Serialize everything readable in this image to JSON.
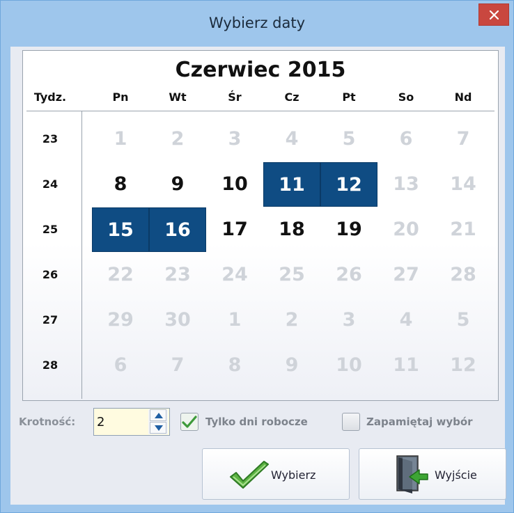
{
  "window": {
    "title": "Wybierz daty"
  },
  "calendar": {
    "month_title": "Czerwiec 2015",
    "week_header": "Tydz.",
    "day_headers": [
      "Pn",
      "Wt",
      "Śr",
      "Cz",
      "Pt",
      "So",
      "Nd"
    ],
    "weeks": [
      {
        "number": "23",
        "days": [
          {
            "d": "1",
            "s": "other"
          },
          {
            "d": "2",
            "s": "other"
          },
          {
            "d": "3",
            "s": "other"
          },
          {
            "d": "4",
            "s": "other"
          },
          {
            "d": "5",
            "s": "other"
          },
          {
            "d": "6",
            "s": "other"
          },
          {
            "d": "7",
            "s": "other"
          }
        ]
      },
      {
        "number": "24",
        "days": [
          {
            "d": "8",
            "s": "cur"
          },
          {
            "d": "9",
            "s": "cur"
          },
          {
            "d": "10",
            "s": "cur"
          },
          {
            "d": "11",
            "s": "sel"
          },
          {
            "d": "12",
            "s": "sel"
          },
          {
            "d": "13",
            "s": "other"
          },
          {
            "d": "14",
            "s": "other"
          }
        ]
      },
      {
        "number": "25",
        "days": [
          {
            "d": "15",
            "s": "sel"
          },
          {
            "d": "16",
            "s": "sel"
          },
          {
            "d": "17",
            "s": "cur"
          },
          {
            "d": "18",
            "s": "cur"
          },
          {
            "d": "19",
            "s": "cur"
          },
          {
            "d": "20",
            "s": "other"
          },
          {
            "d": "21",
            "s": "other"
          }
        ]
      },
      {
        "number": "26",
        "days": [
          {
            "d": "22",
            "s": "other"
          },
          {
            "d": "23",
            "s": "other"
          },
          {
            "d": "24",
            "s": "other"
          },
          {
            "d": "25",
            "s": "other"
          },
          {
            "d": "26",
            "s": "other"
          },
          {
            "d": "27",
            "s": "other"
          },
          {
            "d": "28",
            "s": "other"
          }
        ]
      },
      {
        "number": "27",
        "days": [
          {
            "d": "29",
            "s": "other"
          },
          {
            "d": "30",
            "s": "other"
          },
          {
            "d": "1",
            "s": "other"
          },
          {
            "d": "2",
            "s": "other"
          },
          {
            "d": "3",
            "s": "other"
          },
          {
            "d": "4",
            "s": "other"
          },
          {
            "d": "5",
            "s": "other"
          }
        ]
      },
      {
        "number": "28",
        "days": [
          {
            "d": "6",
            "s": "other"
          },
          {
            "d": "7",
            "s": "other"
          },
          {
            "d": "8",
            "s": "other"
          },
          {
            "d": "9",
            "s": "other"
          },
          {
            "d": "10",
            "s": "other"
          },
          {
            "d": "11",
            "s": "other"
          },
          {
            "d": "12",
            "s": "other"
          }
        ]
      }
    ]
  },
  "options": {
    "krotnosc_label": "Krotność:",
    "krotnosc_value": "2",
    "working_days_label": "Tylko dni robocze",
    "working_days_checked": true,
    "remember_label": "Zapamiętaj wybór",
    "remember_checked": false
  },
  "buttons": {
    "select_label": "Wybierz",
    "exit_label": "Wyjście"
  },
  "icons": {
    "close": "close-icon",
    "select": "checkmark-icon",
    "exit": "exit-door-icon"
  },
  "colors": {
    "selected_day": "#0f4c83",
    "titlebar": "#9ec6ec",
    "close_button": "#c9473f",
    "inactive_day": "#cfd3d9"
  }
}
